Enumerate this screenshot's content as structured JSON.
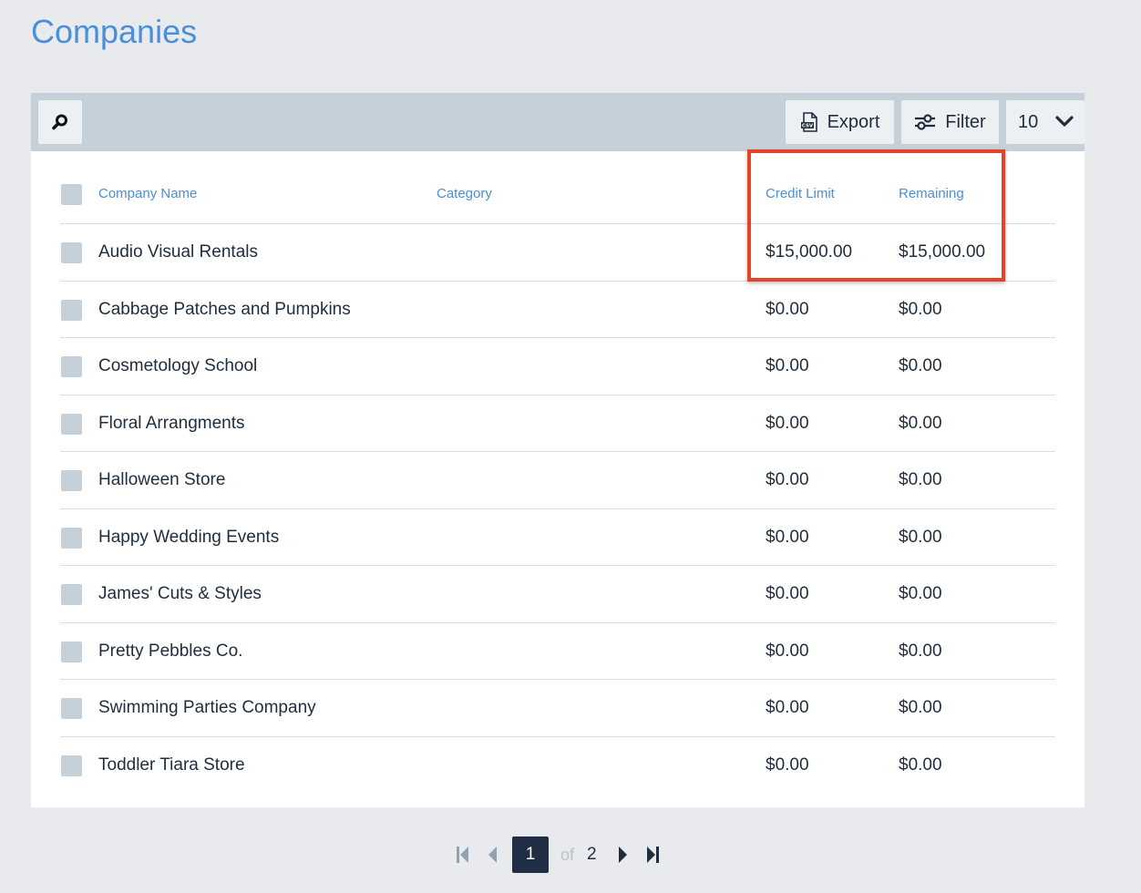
{
  "page": {
    "title": "Companies"
  },
  "toolbar": {
    "export_label": "Export",
    "export_icon": "csv-file-icon",
    "filter_label": "Filter",
    "filter_icon": "sliders-icon",
    "page_size": "10",
    "search_icon": "search-icon"
  },
  "table": {
    "headers": {
      "name": "Company Name",
      "category": "Category",
      "credit_limit": "Credit Limit",
      "remaining": "Remaining"
    },
    "rows": [
      {
        "name": "Audio Visual Rentals",
        "category": "",
        "credit_limit": "$15,000.00",
        "remaining": "$15,000.00"
      },
      {
        "name": "Cabbage Patches and Pumpkins",
        "category": "",
        "credit_limit": "$0.00",
        "remaining": "$0.00"
      },
      {
        "name": "Cosmetology School",
        "category": "",
        "credit_limit": "$0.00",
        "remaining": "$0.00"
      },
      {
        "name": "Floral Arrangments",
        "category": "",
        "credit_limit": "$0.00",
        "remaining": "$0.00"
      },
      {
        "name": "Halloween Store",
        "category": "",
        "credit_limit": "$0.00",
        "remaining": "$0.00"
      },
      {
        "name": "Happy Wedding Events",
        "category": "",
        "credit_limit": "$0.00",
        "remaining": "$0.00"
      },
      {
        "name": "James' Cuts & Styles",
        "category": "",
        "credit_limit": "$0.00",
        "remaining": "$0.00"
      },
      {
        "name": "Pretty Pebbles Co.",
        "category": "",
        "credit_limit": "$0.00",
        "remaining": "$0.00"
      },
      {
        "name": "Swimming Parties Company",
        "category": "",
        "credit_limit": "$0.00",
        "remaining": "$0.00"
      },
      {
        "name": "Toddler Tiara Store",
        "category": "",
        "credit_limit": "$0.00",
        "remaining": "$0.00"
      }
    ]
  },
  "pagination": {
    "current": "1",
    "of_label": "of",
    "total": "2"
  },
  "colors": {
    "accent": "#4a8fd9",
    "highlight": "#e3432b",
    "toolbar_bg": "#c5d0d9",
    "pager_active": "#1f2d45"
  }
}
